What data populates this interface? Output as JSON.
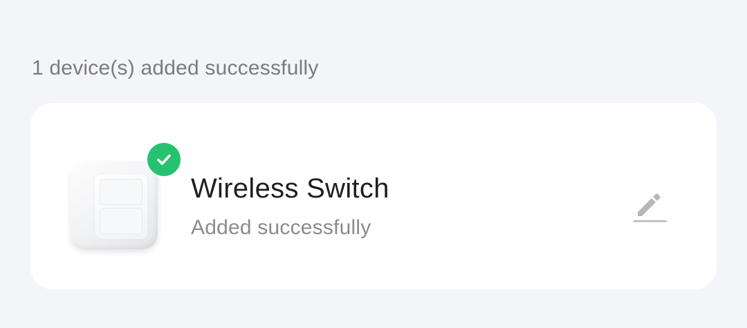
{
  "summary": {
    "text": "1 device(s) added successfully"
  },
  "device": {
    "name": "Wireless Switch",
    "status": "Added successfully",
    "image_icon": "wireless-switch-image",
    "badge_icon": "check-icon",
    "edit_icon": "pencil-icon"
  },
  "colors": {
    "background": "#f4f5f9",
    "card": "#ffffff",
    "success_badge": "#27c26f",
    "title_text": "#1f1f21",
    "secondary_text": "#8a8a8e",
    "edit_icon": "#b8b8bc"
  }
}
